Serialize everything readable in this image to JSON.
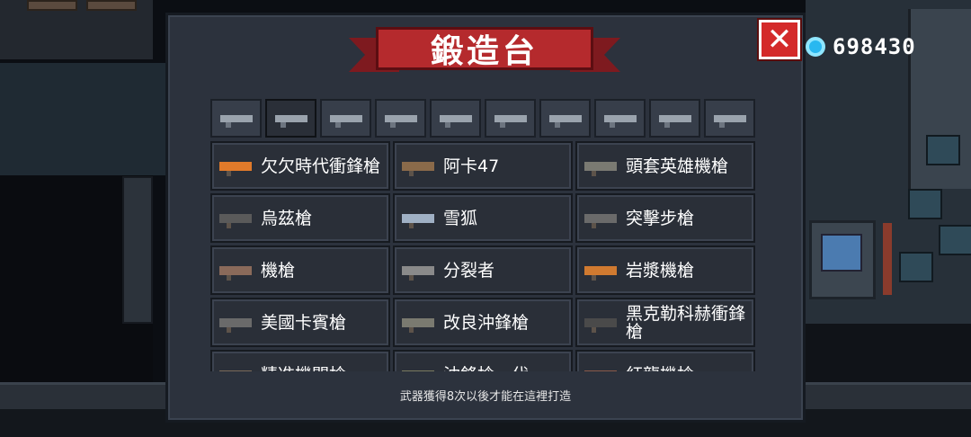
{
  "currency": {
    "icon": "gem-icon",
    "value": "698430",
    "color": "#29b8f0"
  },
  "dialog": {
    "title": "鍛造台",
    "close_icon": "close-icon",
    "accent": "#b52a2d",
    "tabs": [
      {
        "icon": "pistol-icon",
        "selected": false
      },
      {
        "icon": "rifle-icon",
        "selected": true
      },
      {
        "icon": "shotgun-icon",
        "selected": false
      },
      {
        "icon": "launcher-icon",
        "selected": false
      },
      {
        "icon": "cannon-icon",
        "selected": false
      },
      {
        "icon": "bow-icon",
        "selected": false
      },
      {
        "icon": "sword-icon",
        "selected": false
      },
      {
        "icon": "staff-icon",
        "selected": false
      },
      {
        "icon": "shuriken-icon",
        "selected": false
      },
      {
        "icon": "fish-icon",
        "selected": false
      }
    ],
    "weapons": [
      {
        "name": "欠欠時代衝鋒槍",
        "icon_color": "#e07a2a"
      },
      {
        "name": "阿卡47",
        "icon_color": "#8a6a4a"
      },
      {
        "name": "頭套英雄機槍",
        "icon_color": "#7a7a72"
      },
      {
        "name": "烏茲槍",
        "icon_color": "#5a5a5a"
      },
      {
        "name": "雪狐",
        "icon_color": "#9fb0c4"
      },
      {
        "name": "突擊步槍",
        "icon_color": "#6a6a6a"
      },
      {
        "name": "機槍",
        "icon_color": "#8a6a5a"
      },
      {
        "name": "分裂者",
        "icon_color": "#8a8a8a"
      },
      {
        "name": "岩漿機槍",
        "icon_color": "#d07a30"
      },
      {
        "name": "美國卡賓槍",
        "icon_color": "#6a6a6a"
      },
      {
        "name": "改良沖鋒槍",
        "icon_color": "#7a7a70"
      },
      {
        "name": "黑克勒科赫衝鋒槍",
        "icon_color": "#4a4a4a"
      },
      {
        "name": "精准機關槍",
        "icon_color": "#7a6a5a"
      },
      {
        "name": "沖鋒槍一代",
        "icon_color": "#7a7a60"
      },
      {
        "name": "紅龍機槍",
        "icon_color": "#8a5a4a"
      }
    ],
    "hint": "武器獲得8次以後才能在這裡打造"
  }
}
